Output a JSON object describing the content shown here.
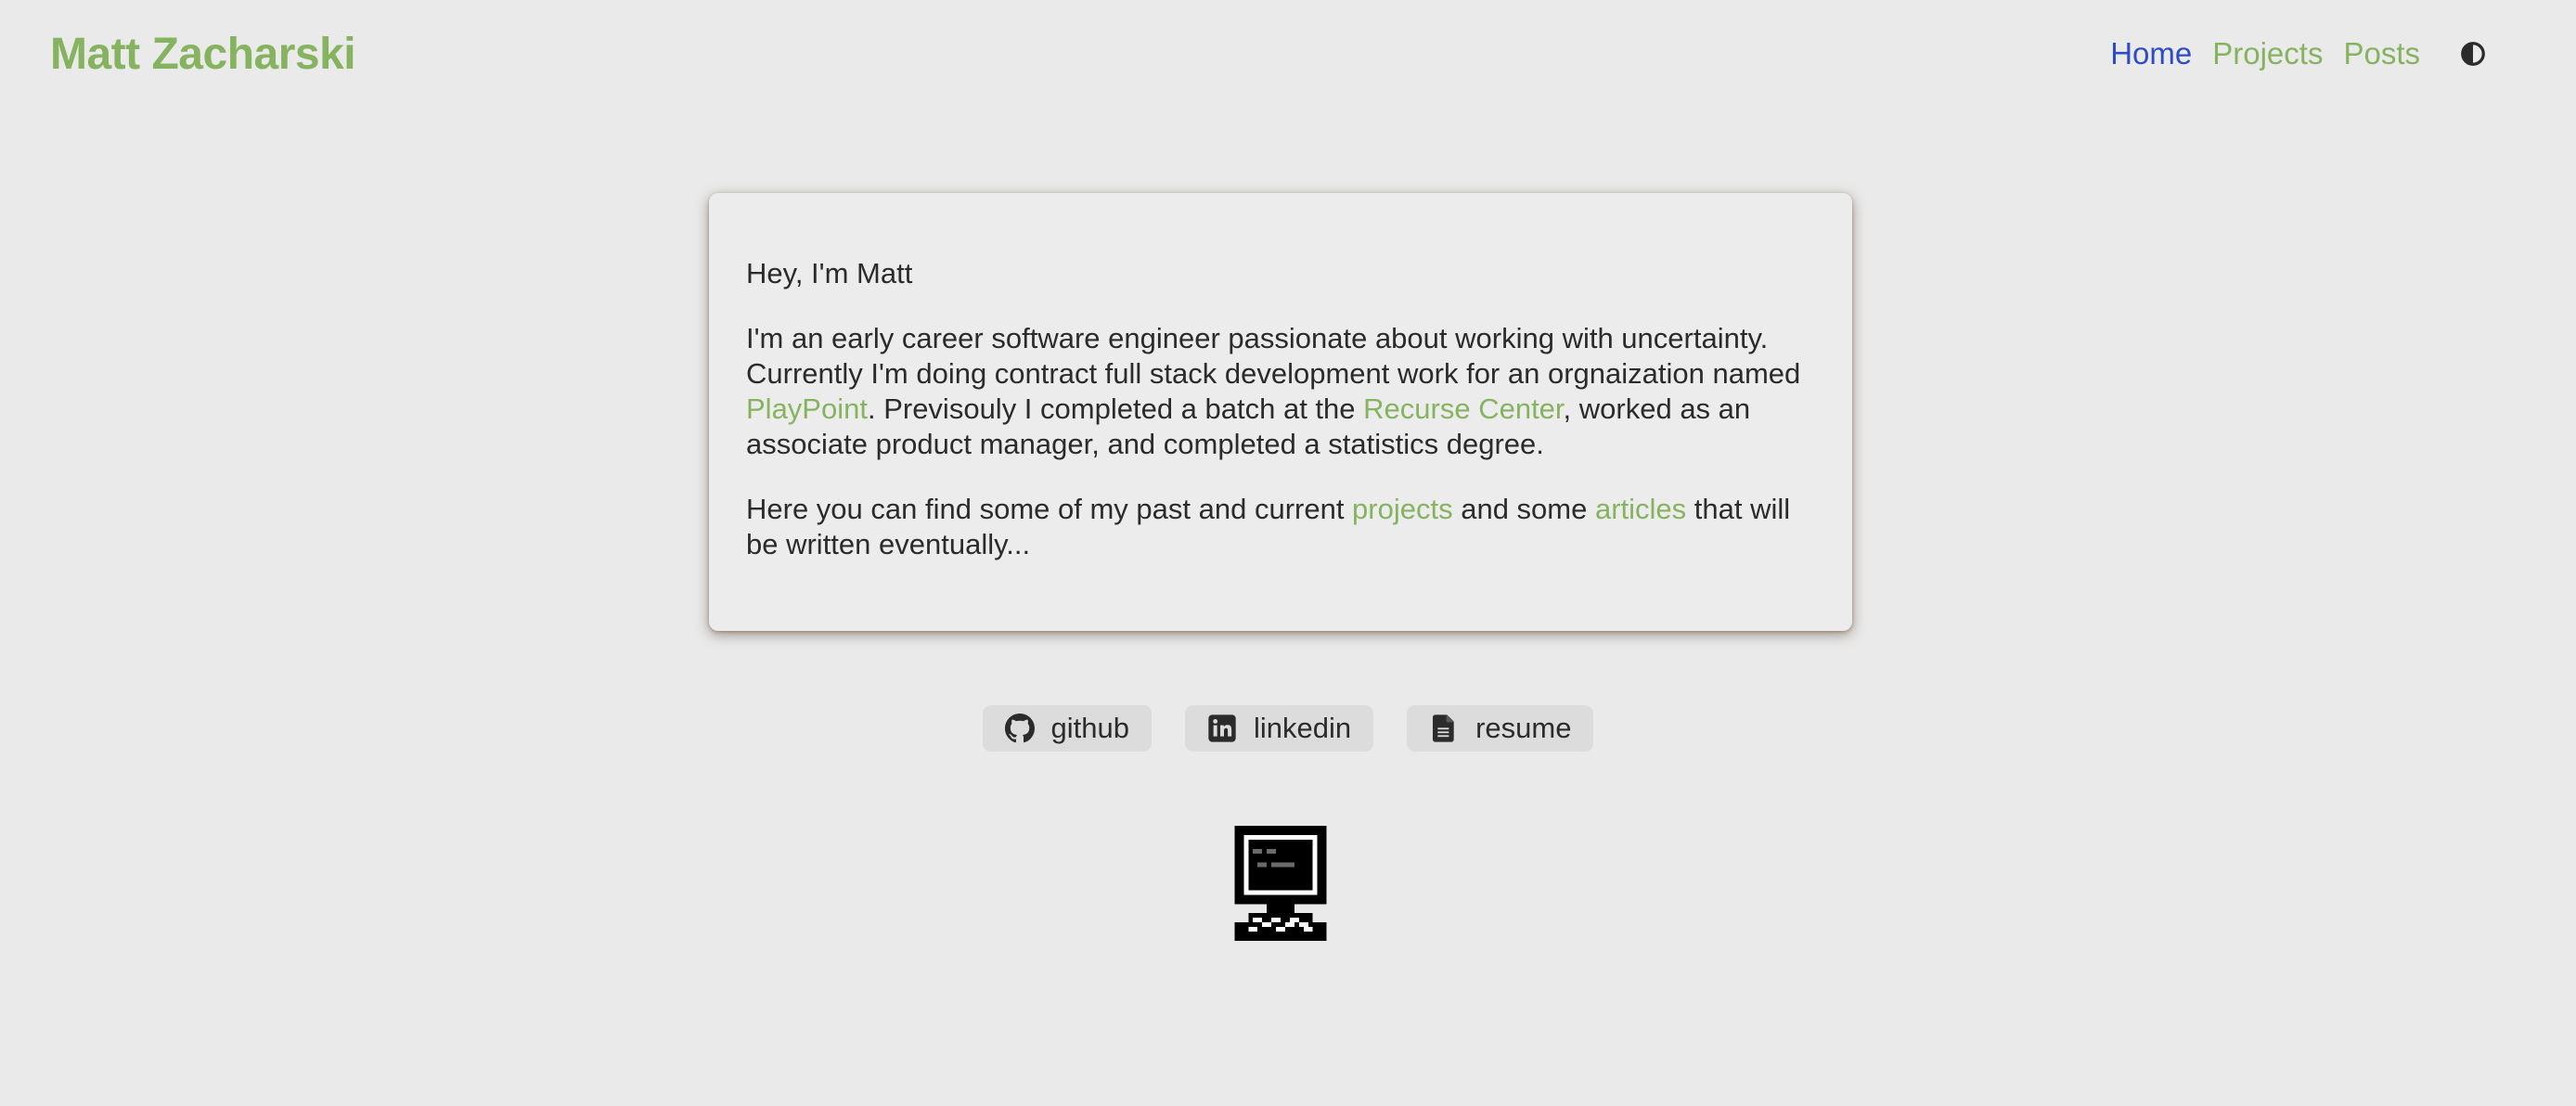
{
  "header": {
    "site_title": "Matt Zacharski",
    "nav": [
      {
        "label": "Home",
        "active": true
      },
      {
        "label": "Projects",
        "active": false
      },
      {
        "label": "Posts",
        "active": false
      }
    ],
    "theme_toggle_icon": "contrast-half-circle-icon"
  },
  "intro": {
    "greeting": "Hey, I'm Matt",
    "p1_a": "I'm an early career software engineer passionate about working with uncertainty. Currently I'm doing contract full stack development work for an orgnaization named ",
    "p1_link1": "PlayPoint",
    "p1_b": ". Previsouly I completed a batch at the ",
    "p1_link2": "Recurse Center",
    "p1_c": ", worked as an associate product manager, and completed a statistics degree.",
    "p2_a": "Here you can find some of my past and current ",
    "p2_link1": "projects",
    "p2_b": " and some ",
    "p2_link2": "articles",
    "p2_c": " that will be written eventually..."
  },
  "links": [
    {
      "label": "github",
      "icon": "github-icon"
    },
    {
      "label": "linkedin",
      "icon": "linkedin-icon"
    },
    {
      "label": "resume",
      "icon": "document-icon"
    }
  ],
  "footer_image": "pixel-computer-icon",
  "colors": {
    "accent": "#86b35f",
    "active_nav": "#2e4cc4",
    "background": "#eaeaea",
    "text": "#2b2b2b",
    "pill_background": "#dcdcdc"
  }
}
